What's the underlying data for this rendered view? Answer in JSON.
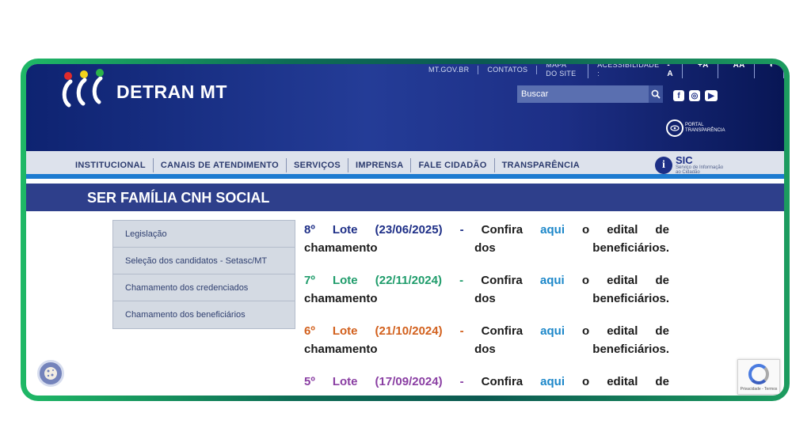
{
  "header": {
    "logo_text": "DETRAN MT",
    "top_links": [
      "MT.GOV.BR",
      "CONTATOS",
      "MAPA DO SITE",
      "ACESSIBILIDADE :"
    ],
    "accessibility": [
      "-A",
      "+A",
      "AA",
      "◐"
    ],
    "search_placeholder": "Buscar",
    "social_icons": [
      "facebook-icon",
      "instagram-icon",
      "youtube-icon"
    ],
    "portal_line1": "PORTAL",
    "portal_line2": "TRANSPARÊNCIA"
  },
  "nav": {
    "items": [
      "INSTITUCIONAL",
      "CANAIS DE ATENDIMENTO",
      "SERVIÇOS",
      "IMPRENSA",
      "FALE CIDADÃO",
      "TRANSPARÊNCIA"
    ],
    "sic_title": "SIC",
    "sic_sub1": "Serviço de Informação",
    "sic_sub2": "ao Cidadão"
  },
  "page_title": "SER FAMÍLIA CNH SOCIAL",
  "sidebar": {
    "items": [
      "Legislação",
      "Seleção dos candidatos - Setasc/MT",
      "Chamamento dos credenciados",
      "Chamamento dos beneficiários"
    ]
  },
  "lotes": [
    {
      "number": "8º",
      "word": "Lote",
      "date": "(23/06/2025)",
      "dash": "-",
      "confira": "Confira",
      "link": "aqui",
      "rest1": "o",
      "rest2": "edital",
      "rest3": "de",
      "line2": "chamamento dos beneficiários.",
      "color": "#1e2f87"
    },
    {
      "number": "7º",
      "word": "Lote",
      "date": "(22/11/2024)",
      "dash": "-",
      "confira": "Confira",
      "link": "aqui",
      "rest1": "o",
      "rest2": "edital",
      "rest3": "de",
      "line2": "chamamento dos beneficiários.",
      "color": "#1f9c6b"
    },
    {
      "number": "6º",
      "word": "Lote",
      "date": "(21/10/2024)",
      "dash": "-",
      "confira": "Confira",
      "link": "aqui",
      "rest1": "o",
      "rest2": "edital",
      "rest3": "de",
      "line2": "chamamento dos beneficiários.",
      "color": "#d2601d"
    },
    {
      "number": "5º",
      "word": "Lote",
      "date": "(17/09/2024)",
      "dash": "-",
      "confira": "Confira",
      "link": "aqui",
      "rest1": "o",
      "rest2": "edital",
      "rest3": "de",
      "line2": "",
      "color": "#8a3fa3"
    }
  ],
  "recaptcha_text": "Privacidade - Termos",
  "colors": {
    "dot_red": "#e12b2b",
    "dot_yellow": "#f2d21b",
    "dot_green": "#2cb34a"
  }
}
